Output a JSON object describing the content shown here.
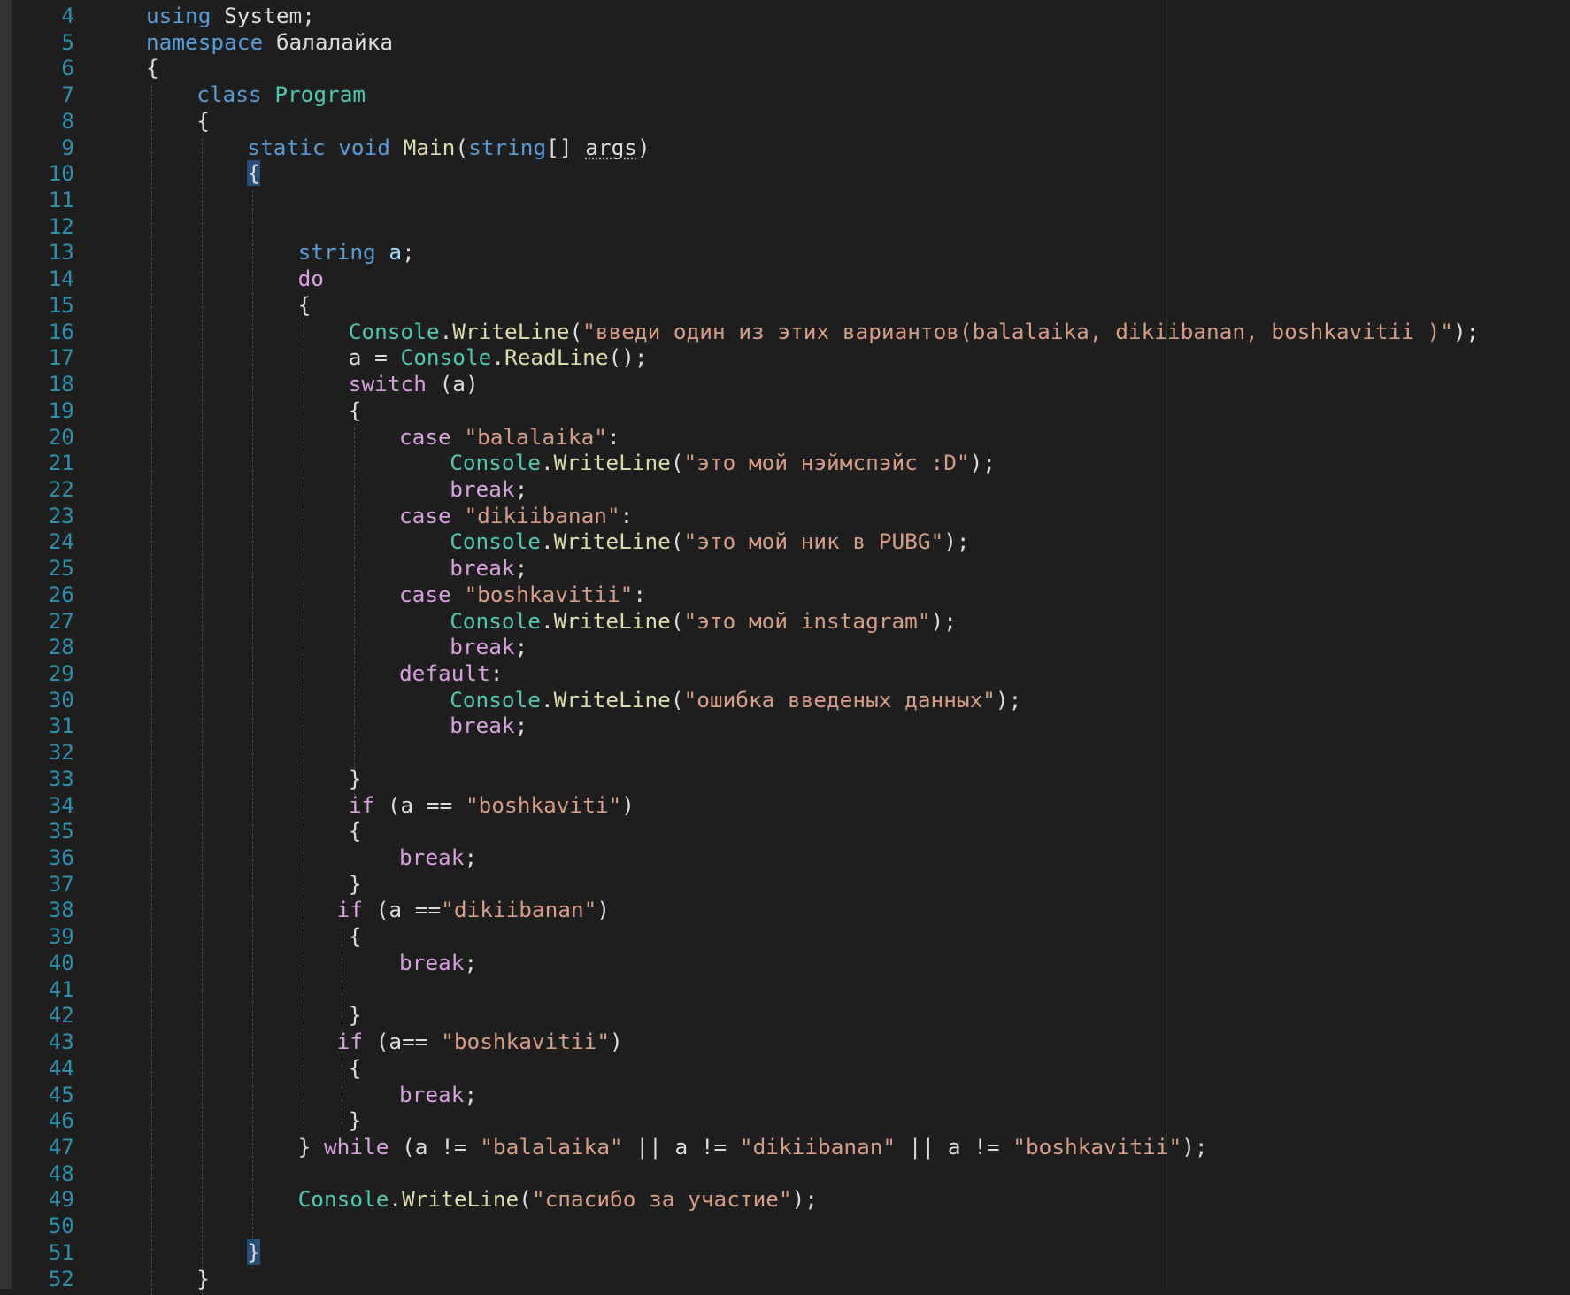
{
  "editor": {
    "lines": [
      {
        "n": "4",
        "indent": 0,
        "tokens": [
          [
            "kw",
            "using"
          ],
          [
            "p",
            " System;"
          ]
        ]
      },
      {
        "n": "5",
        "indent": 0,
        "tokens": [
          [
            "kw",
            "namespace"
          ],
          [
            "p",
            " балалайка"
          ]
        ]
      },
      {
        "n": "6",
        "indent": 0,
        "tokens": [
          [
            "p",
            "{"
          ]
        ]
      },
      {
        "n": "7",
        "indent": 1,
        "tokens": [
          [
            "kw",
            "class"
          ],
          [
            "p",
            " "
          ],
          [
            "ty",
            "Program"
          ]
        ]
      },
      {
        "n": "8",
        "indent": 1,
        "tokens": [
          [
            "p",
            "{"
          ]
        ]
      },
      {
        "n": "9",
        "indent": 2,
        "tokens": [
          [
            "kw",
            "static"
          ],
          [
            "p",
            " "
          ],
          [
            "kw",
            "void"
          ],
          [
            "p",
            " "
          ],
          [
            "fn",
            "Main"
          ],
          [
            "p",
            "("
          ],
          [
            "kw",
            "string"
          ],
          [
            "p",
            "[] "
          ],
          [
            "dotted",
            "args"
          ],
          [
            "p",
            ")"
          ]
        ]
      },
      {
        "n": "10",
        "indent": 2,
        "tokens": [
          [
            "hl",
            "{"
          ]
        ]
      },
      {
        "n": "11",
        "indent": 0,
        "tokens": []
      },
      {
        "n": "12",
        "indent": 0,
        "tokens": []
      },
      {
        "n": "13",
        "indent": 3,
        "tokens": [
          [
            "kw",
            "string"
          ],
          [
            "p",
            " "
          ],
          [
            "var",
            "a"
          ],
          [
            "p",
            ";"
          ]
        ]
      },
      {
        "n": "14",
        "indent": 3,
        "tokens": [
          [
            "ctl",
            "do"
          ]
        ]
      },
      {
        "n": "15",
        "indent": 3,
        "tokens": [
          [
            "p",
            "{"
          ]
        ]
      },
      {
        "n": "16",
        "indent": 4,
        "tokens": [
          [
            "ty",
            "Console"
          ],
          [
            "p",
            "."
          ],
          [
            "fn",
            "WriteLine"
          ],
          [
            "p",
            "("
          ],
          [
            "str",
            "\"введи один из этих вариантов(balalaika, dikiibanan, boshkavitii )\""
          ],
          [
            "p",
            ");"
          ]
        ]
      },
      {
        "n": "17",
        "indent": 4,
        "tokens": [
          [
            "p",
            "a = "
          ],
          [
            "ty",
            "Console"
          ],
          [
            "p",
            "."
          ],
          [
            "fn",
            "ReadLine"
          ],
          [
            "p",
            "();"
          ]
        ]
      },
      {
        "n": "18",
        "indent": 4,
        "tokens": [
          [
            "ctl",
            "switch"
          ],
          [
            "p",
            " (a)"
          ]
        ]
      },
      {
        "n": "19",
        "indent": 4,
        "tokens": [
          [
            "p",
            "{"
          ]
        ]
      },
      {
        "n": "20",
        "indent": 5,
        "tokens": [
          [
            "ctl",
            "case"
          ],
          [
            "p",
            " "
          ],
          [
            "str",
            "\"balalaika\""
          ],
          [
            "p",
            ":"
          ]
        ]
      },
      {
        "n": "21",
        "indent": 6,
        "tokens": [
          [
            "ty",
            "Console"
          ],
          [
            "p",
            "."
          ],
          [
            "fn",
            "WriteLine"
          ],
          [
            "p",
            "("
          ],
          [
            "str",
            "\"это мой нэймспэйс :D\""
          ],
          [
            "p",
            ");"
          ]
        ]
      },
      {
        "n": "22",
        "indent": 6,
        "tokens": [
          [
            "ctl",
            "break"
          ],
          [
            "p",
            ";"
          ]
        ]
      },
      {
        "n": "23",
        "indent": 5,
        "tokens": [
          [
            "ctl",
            "case"
          ],
          [
            "p",
            " "
          ],
          [
            "str",
            "\"dikiibanan\""
          ],
          [
            "p",
            ":"
          ]
        ]
      },
      {
        "n": "24",
        "indent": 6,
        "tokens": [
          [
            "ty",
            "Console"
          ],
          [
            "p",
            "."
          ],
          [
            "fn",
            "WriteLine"
          ],
          [
            "p",
            "("
          ],
          [
            "str",
            "\"это мой ник в PUBG\""
          ],
          [
            "p",
            ");"
          ]
        ]
      },
      {
        "n": "25",
        "indent": 6,
        "tokens": [
          [
            "ctl",
            "break"
          ],
          [
            "p",
            ";"
          ]
        ]
      },
      {
        "n": "26",
        "indent": 5,
        "tokens": [
          [
            "ctl",
            "case"
          ],
          [
            "p",
            " "
          ],
          [
            "str",
            "\"boshkavitii\""
          ],
          [
            "p",
            ":"
          ]
        ]
      },
      {
        "n": "27",
        "indent": 6,
        "tokens": [
          [
            "ty",
            "Console"
          ],
          [
            "p",
            "."
          ],
          [
            "fn",
            "WriteLine"
          ],
          [
            "p",
            "("
          ],
          [
            "str",
            "\"это мой instagram\""
          ],
          [
            "p",
            ");"
          ]
        ]
      },
      {
        "n": "28",
        "indent": 6,
        "tokens": [
          [
            "ctl",
            "break"
          ],
          [
            "p",
            ";"
          ]
        ]
      },
      {
        "n": "29",
        "indent": 5,
        "tokens": [
          [
            "ctl",
            "default"
          ],
          [
            "p",
            ":"
          ]
        ]
      },
      {
        "n": "30",
        "indent": 6,
        "tokens": [
          [
            "ty",
            "Console"
          ],
          [
            "p",
            "."
          ],
          [
            "fn",
            "WriteLine"
          ],
          [
            "p",
            "("
          ],
          [
            "str",
            "\"ошибка введеных данных\""
          ],
          [
            "p",
            ");"
          ]
        ]
      },
      {
        "n": "31",
        "indent": 6,
        "tokens": [
          [
            "ctl",
            "break"
          ],
          [
            "p",
            ";"
          ]
        ]
      },
      {
        "n": "32",
        "indent": 0,
        "tokens": []
      },
      {
        "n": "33",
        "indent": 4,
        "tokens": [
          [
            "p",
            "}"
          ]
        ]
      },
      {
        "n": "34",
        "indent": 4,
        "tokens": [
          [
            "ctl",
            "if"
          ],
          [
            "p",
            " (a == "
          ],
          [
            "str",
            "\"boshkaviti\""
          ],
          [
            "p",
            ")"
          ]
        ]
      },
      {
        "n": "35",
        "indent": 4,
        "tokens": [
          [
            "p",
            "{"
          ]
        ]
      },
      {
        "n": "36",
        "indent": 5,
        "tokens": [
          [
            "ctl",
            "break"
          ],
          [
            "p",
            ";"
          ]
        ]
      },
      {
        "n": "37",
        "indent": 4,
        "tokens": [
          [
            "p",
            "}"
          ]
        ]
      },
      {
        "n": "38",
        "indent": 3,
        "tokens": [
          [
            "p",
            "   "
          ],
          [
            "ctl",
            "if"
          ],
          [
            "p",
            " (a =="
          ],
          [
            "str",
            "\"dikiibanan\""
          ],
          [
            "p",
            ")"
          ]
        ]
      },
      {
        "n": "39",
        "indent": 4,
        "tokens": [
          [
            "p",
            "{"
          ]
        ]
      },
      {
        "n": "40",
        "indent": 5,
        "tokens": [
          [
            "ctl",
            "break"
          ],
          [
            "p",
            ";"
          ]
        ]
      },
      {
        "n": "41",
        "indent": 0,
        "tokens": []
      },
      {
        "n": "42",
        "indent": 4,
        "tokens": [
          [
            "p",
            "}"
          ]
        ]
      },
      {
        "n": "43",
        "indent": 3,
        "tokens": [
          [
            "p",
            "   "
          ],
          [
            "ctl",
            "if"
          ],
          [
            "p",
            " (a== "
          ],
          [
            "str",
            "\"boshkavitii\""
          ],
          [
            "p",
            ")"
          ]
        ]
      },
      {
        "n": "44",
        "indent": 4,
        "tokens": [
          [
            "p",
            "{"
          ]
        ]
      },
      {
        "n": "45",
        "indent": 5,
        "tokens": [
          [
            "ctl",
            "break"
          ],
          [
            "p",
            ";"
          ]
        ]
      },
      {
        "n": "46",
        "indent": 4,
        "tokens": [
          [
            "p",
            "}"
          ]
        ]
      },
      {
        "n": "47",
        "indent": 3,
        "tokens": [
          [
            "p",
            "} "
          ],
          [
            "ctl",
            "while"
          ],
          [
            "p",
            " (a != "
          ],
          [
            "str",
            "\"balalaika\""
          ],
          [
            "p",
            " || a != "
          ],
          [
            "str",
            "\"dikiibanan\""
          ],
          [
            "p",
            " || a != "
          ],
          [
            "str",
            "\"boshkavitii\""
          ],
          [
            "p",
            ");"
          ]
        ]
      },
      {
        "n": "48",
        "indent": 0,
        "tokens": []
      },
      {
        "n": "49",
        "indent": 3,
        "tokens": [
          [
            "ty",
            "Console"
          ],
          [
            "p",
            "."
          ],
          [
            "fn",
            "WriteLine"
          ],
          [
            "p",
            "("
          ],
          [
            "str",
            "\"спасибо за участие\""
          ],
          [
            "p",
            ");"
          ]
        ]
      },
      {
        "n": "50",
        "indent": 0,
        "tokens": []
      },
      {
        "n": "51",
        "indent": 2,
        "tokens": [
          [
            "hl",
            "}"
          ]
        ]
      },
      {
        "n": "52",
        "indent": 1,
        "tokens": [
          [
            "p",
            "}"
          ]
        ]
      }
    ]
  }
}
